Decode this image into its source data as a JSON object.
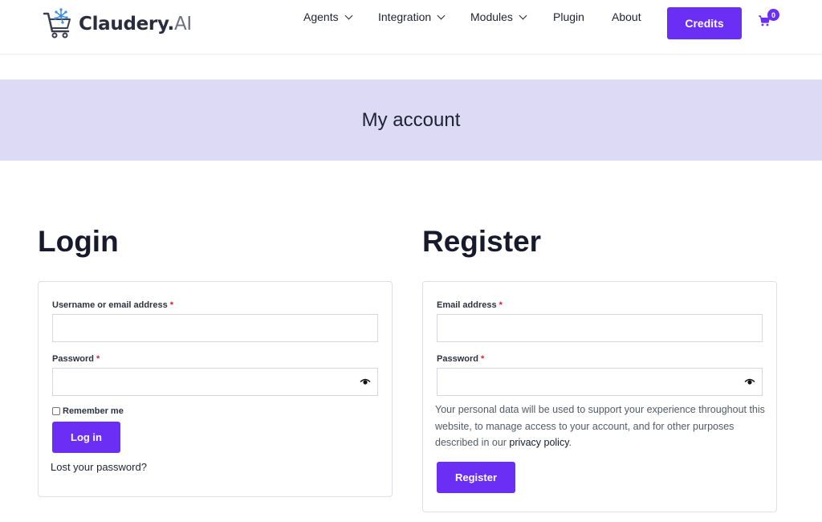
{
  "header": {
    "logo_main": "Claudery.",
    "logo_suffix": "AI",
    "nav": {
      "agents": "Agents",
      "integration": "Integration",
      "modules": "Modules",
      "plugin": "Plugin",
      "about": "About"
    },
    "credits_label": "Credits",
    "cart_count": "0"
  },
  "banner": {
    "title": "My account"
  },
  "login": {
    "title": "Login",
    "username_label": "Username or email address",
    "password_label": "Password",
    "required_mark": "*",
    "remember_label": "Remember me",
    "submit_label": "Log in",
    "lost_password": "Lost your password?"
  },
  "register": {
    "title": "Register",
    "email_label": "Email address",
    "password_label": "Password",
    "required_mark": "*",
    "policy_before": "Your personal data will be used to support your experience throughout this website, to manage access to your account, and for other purposes described in our ",
    "policy_link": "privacy policy",
    "policy_after": ".",
    "submit_label": "Register"
  },
  "colors": {
    "accent": "#6a2ef5",
    "banner_bg": "#dcdaf5",
    "required": "#d0252f"
  },
  "icons": {
    "logo": "cart-network-logo-icon",
    "cart": "shopping-cart-icon",
    "password_toggle": "eye-icon"
  }
}
